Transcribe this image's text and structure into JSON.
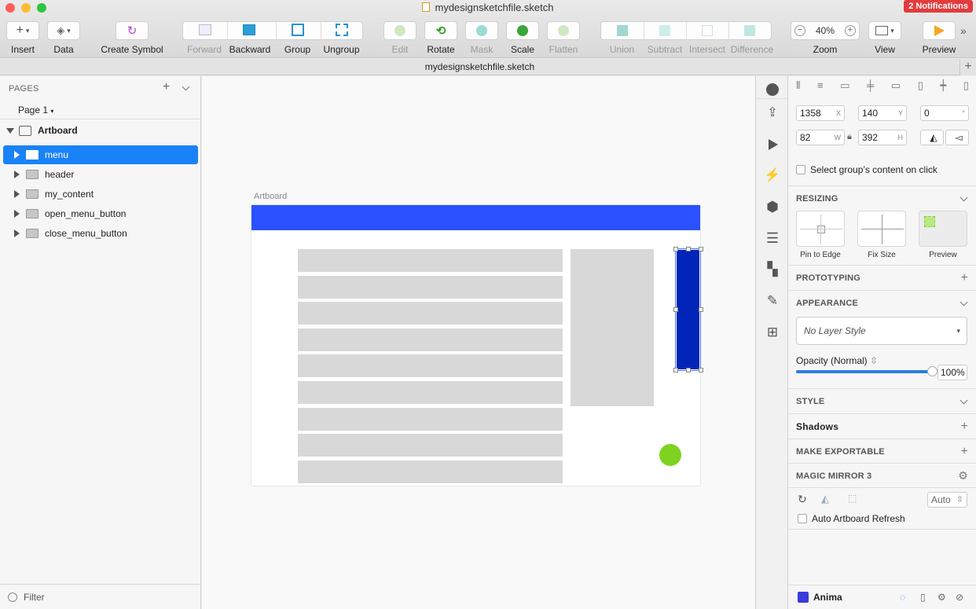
{
  "window": {
    "title": "mydesignsketchfile.sketch",
    "notifications": "2 Notifications",
    "tab_label": "mydesignsketchfile.sketch"
  },
  "toolbar": {
    "insert": "Insert",
    "data": "Data",
    "create_symbol": "Create Symbol",
    "forward": "Forward",
    "backward": "Backward",
    "group": "Group",
    "ungroup": "Ungroup",
    "edit": "Edit",
    "rotate": "Rotate",
    "mask": "Mask",
    "scale": "Scale",
    "flatten": "Flatten",
    "union": "Union",
    "subtract": "Subtract",
    "intersect": "Intersect",
    "difference": "Difference",
    "zoom": "Zoom",
    "zoom_value": "40%",
    "view": "View",
    "preview": "Preview"
  },
  "sidebar": {
    "pages_header": "PAGES",
    "current_page": "Page 1",
    "artboard": "Artboard",
    "layers": [
      {
        "name": "menu",
        "selected": true
      },
      {
        "name": "header"
      },
      {
        "name": "my_content"
      },
      {
        "name": "open_menu_button"
      },
      {
        "name": "close_menu_button"
      }
    ],
    "filter": "Filter"
  },
  "canvas": {
    "artboard_label": "Artboard",
    "header_color": "#2b50ff",
    "menu_color": "#0025b8",
    "button_color": "#7ed321",
    "content_color": "#d8d8d8"
  },
  "inspector": {
    "x": "1358",
    "x_s": "X",
    "y": "140",
    "y_s": "Y",
    "rotation": "0",
    "rotation_s": "°",
    "w": "82",
    "w_s": "W",
    "h": "392",
    "h_s": "H",
    "select_group": "Select group’s content on click",
    "resizing": "RESIZING",
    "pin_to_edge": "Pin to Edge",
    "fix_size": "Fix Size",
    "preview": "Preview",
    "prototyping": "PROTOTYPING",
    "appearance": "APPEARANCE",
    "layer_style": "No Layer Style",
    "opacity_label": "Opacity (Normal)",
    "opacity_value": "100%",
    "opacity": 1.0,
    "style": "STYLE",
    "shadows": "Shadows",
    "make_exportable": "MAKE EXPORTABLE",
    "magic_mirror": "MAGIC MIRROR 3",
    "auto": "Auto",
    "auto_refresh": "Auto Artboard Refresh",
    "anima": "Anima"
  }
}
